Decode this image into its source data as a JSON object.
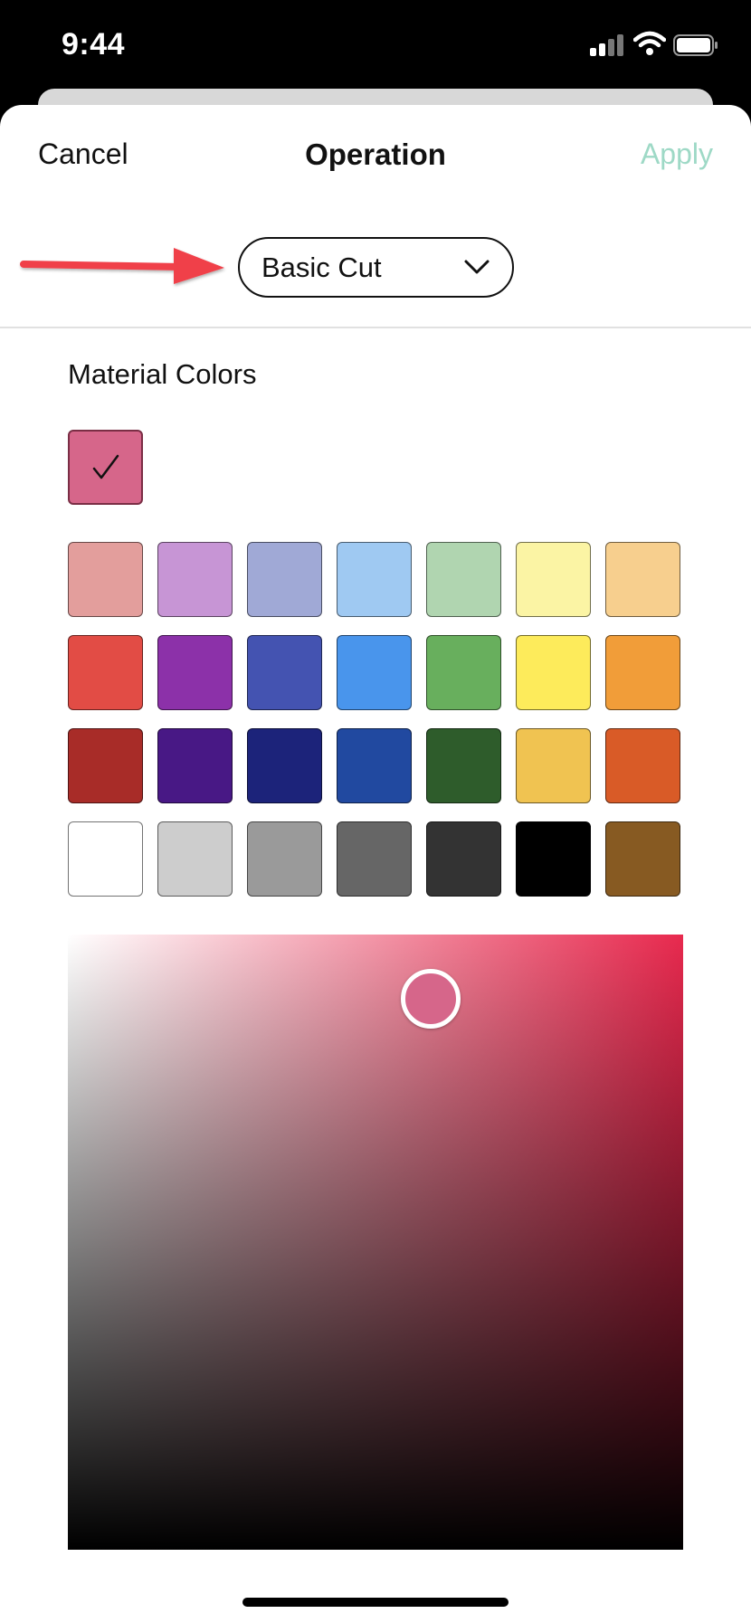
{
  "status_bar": {
    "time": "9:44"
  },
  "header": {
    "cancel_label": "Cancel",
    "title": "Operation",
    "apply_label": "Apply"
  },
  "operation_select": {
    "selected": "Basic Cut"
  },
  "material_colors": {
    "title": "Material Colors",
    "selected_color": "#d6668a",
    "swatches": [
      [
        "#e39e9c",
        "#c795d5",
        "#a0a9d6",
        "#9fc9f2",
        "#b0d5b0",
        "#fbf4a4",
        "#f7cf8e"
      ],
      [
        "#e24c45",
        "#8c31a9",
        "#4453b1",
        "#4995ec",
        "#68af5d",
        "#fdeb5b",
        "#f19d39"
      ],
      [
        "#a82c28",
        "#481885",
        "#1c237a",
        "#2149a0",
        "#2e5c2b",
        "#f0c351",
        "#d95b27"
      ],
      [
        "#ffffff",
        "#cdcdcd",
        "#9a9a9a",
        "#666666",
        "#333333",
        "#000000",
        "#875a22"
      ]
    ]
  },
  "color_picker": {
    "hue_color": "#e8294e",
    "handle_color": "#d6668a"
  },
  "colors": {
    "apply_disabled": "#9ed9c6",
    "annotation_arrow": "#f0404a"
  }
}
